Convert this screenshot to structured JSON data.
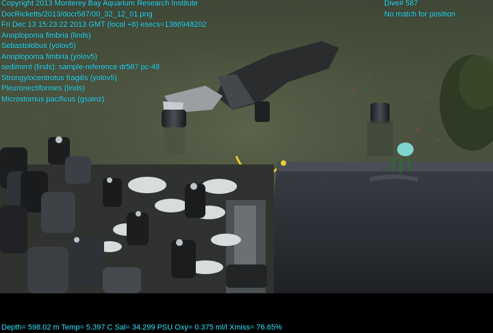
{
  "header_left": [
    "Copyright 2013 Monterey Bay Aquarium Research Institute",
    "DocRicketts/2013/docr587/00_32_12_01.png",
    "Fri Dec 13 15:23:22 2013 GMT (local +8)  esecs=1386948202",
    "Anoplopoma fimbria (linds)",
    "Sebastolobus (yolov5)",
    "Anoplopoma fimbria (yolov5)",
    "sediment (linds): sample-reference dr587 pc-48",
    "Strongylocentrotus fragilis (yolov5)",
    "Pleuronectiformes (linds)",
    "Microstomus pacificus (gsainz)"
  ],
  "header_right": [
    "Dive# 587",
    "No match for position"
  ],
  "footer": "Depth= 598.02 m  Temp= 5.397 C  Sal= 34.299 PSU  Oxy= 0.375 ml/l  Xmiss= 76.65%",
  "colors": {
    "overlay_text": "#33e6ff",
    "seafloor": "#4b5340",
    "letterbox": "#000000"
  }
}
